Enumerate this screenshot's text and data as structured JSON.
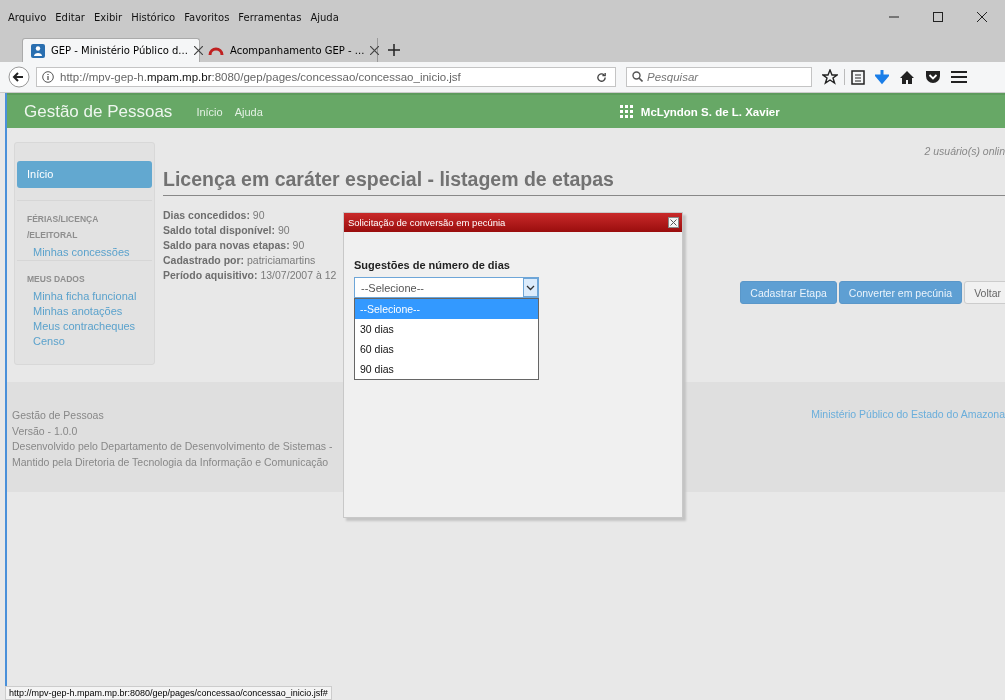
{
  "menu": [
    "Arquivo",
    "Editar",
    "Exibir",
    "Histórico",
    "Favoritos",
    "Ferramentas",
    "Ajuda"
  ],
  "tabs": [
    {
      "title": "GEP - Ministério Público d...",
      "selected": true
    },
    {
      "title": "Acompanhamento GEP - ...",
      "selected": false
    }
  ],
  "address": {
    "url": "http://mpv-gep-h.**mpam.mp.br**:8080/gep/pages/concessao/concessao_inicio.jsf"
  },
  "search": {
    "placeholder": "Pesquisar"
  },
  "app_header": {
    "title": "Gestão de Pessoas",
    "nav": [
      "Início",
      "Ajuda"
    ],
    "user": "McLyndon S. de L. Xavier"
  },
  "sidebar": {
    "items": [
      {
        "kind": "link",
        "label": "Início",
        "selected": true
      },
      {
        "kind": "heading",
        "label": "FÉRIAS/LICENÇA /ELEITORAL"
      },
      {
        "kind": "link",
        "label": "Minhas concessões",
        "selected": false
      },
      {
        "kind": "heading",
        "label": "MEUS DADOS"
      },
      {
        "kind": "link",
        "label": "Minha ficha funcional",
        "selected": false
      },
      {
        "kind": "link",
        "label": "Minhas anotações",
        "selected": false
      },
      {
        "kind": "link",
        "label": "Meus contracheques",
        "selected": false
      },
      {
        "kind": "link",
        "label": "Censo",
        "selected": false
      }
    ]
  },
  "online": "2 usuário(s) onlin",
  "page_title": "Licença em caráter especial - listagem de etapas",
  "details": [
    {
      "label": "Dias concedidos:",
      "value": "90"
    },
    {
      "label": "Saldo total disponível:",
      "value": "90"
    },
    {
      "label": "Saldo para novas etapas:",
      "value": "90"
    },
    {
      "label": "Cadastrado por:",
      "value": "patriciamartins"
    },
    {
      "label": "Período aquisitivo:",
      "value": "13/07/2007 à 12"
    }
  ],
  "buttons": [
    {
      "label": "Cadastrar Etapa",
      "kind": "primary"
    },
    {
      "label": "Converter em pecúnia",
      "kind": "primary"
    },
    {
      "label": "Voltar",
      "kind": "default"
    }
  ],
  "footer": {
    "lines": [
      "Gestão de Pessoas",
      "Versão - 1.0.0",
      "Desenvolvido pelo Departamento de Desenvolvimento de Sistemas -",
      "Mantido pela Diretoria de Tecnologia da Informação e Comunicação"
    ],
    "link": "Ministério Público do Estado do Amazona"
  },
  "dialog": {
    "title": "Solicitação de conversão em pecúnia",
    "field_label": "Sugestões de número de dias",
    "select": {
      "value": "--Selecione--",
      "expanded": true,
      "options": [
        {
          "label": "--Selecione--",
          "selected": true
        },
        {
          "label": "30 dias",
          "selected": false
        },
        {
          "label": "60 dias",
          "selected": false
        },
        {
          "label": "90 dias",
          "selected": false
        }
      ]
    }
  },
  "status_url": "http://mpv-gep-h.mpam.mp.br:8080/gep/pages/concessao/concessao_inicio.jsf#"
}
